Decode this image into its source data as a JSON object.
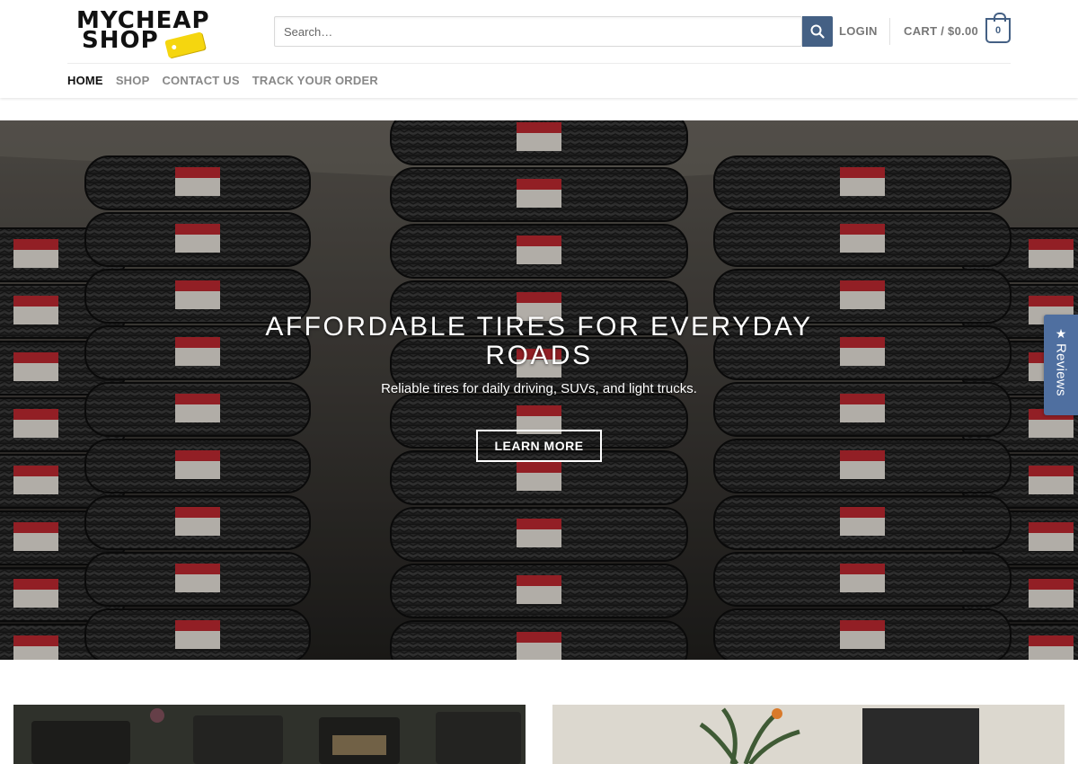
{
  "header": {
    "logo": {
      "line1": "MYCHEAP",
      "line2": "SHOP"
    },
    "search": {
      "placeholder": "Search…",
      "icon": "search-icon"
    },
    "login_label": "LOGIN",
    "cart_label": "CART / $0.00",
    "cart_count": "0",
    "accent_color": "#446084"
  },
  "nav": {
    "items": [
      {
        "label": "HOME",
        "active": true
      },
      {
        "label": "SHOP"
      },
      {
        "label": "CONTACT US"
      },
      {
        "label": "TRACK YOUR ORDER"
      }
    ]
  },
  "hero": {
    "title": "AFFORDABLE TIRES FOR EVERYDAY ROADS",
    "subtitle": "Reliable tires for daily driving, SUVs, and light trucks.",
    "button_label": "LEARN MORE"
  },
  "reviews_tab": {
    "icon": "star-icon",
    "label": "Reviews",
    "color": "#4f6fa0"
  },
  "promo": {
    "left_image": "patio-furniture-image",
    "right_image": "indoor-plant-image"
  }
}
